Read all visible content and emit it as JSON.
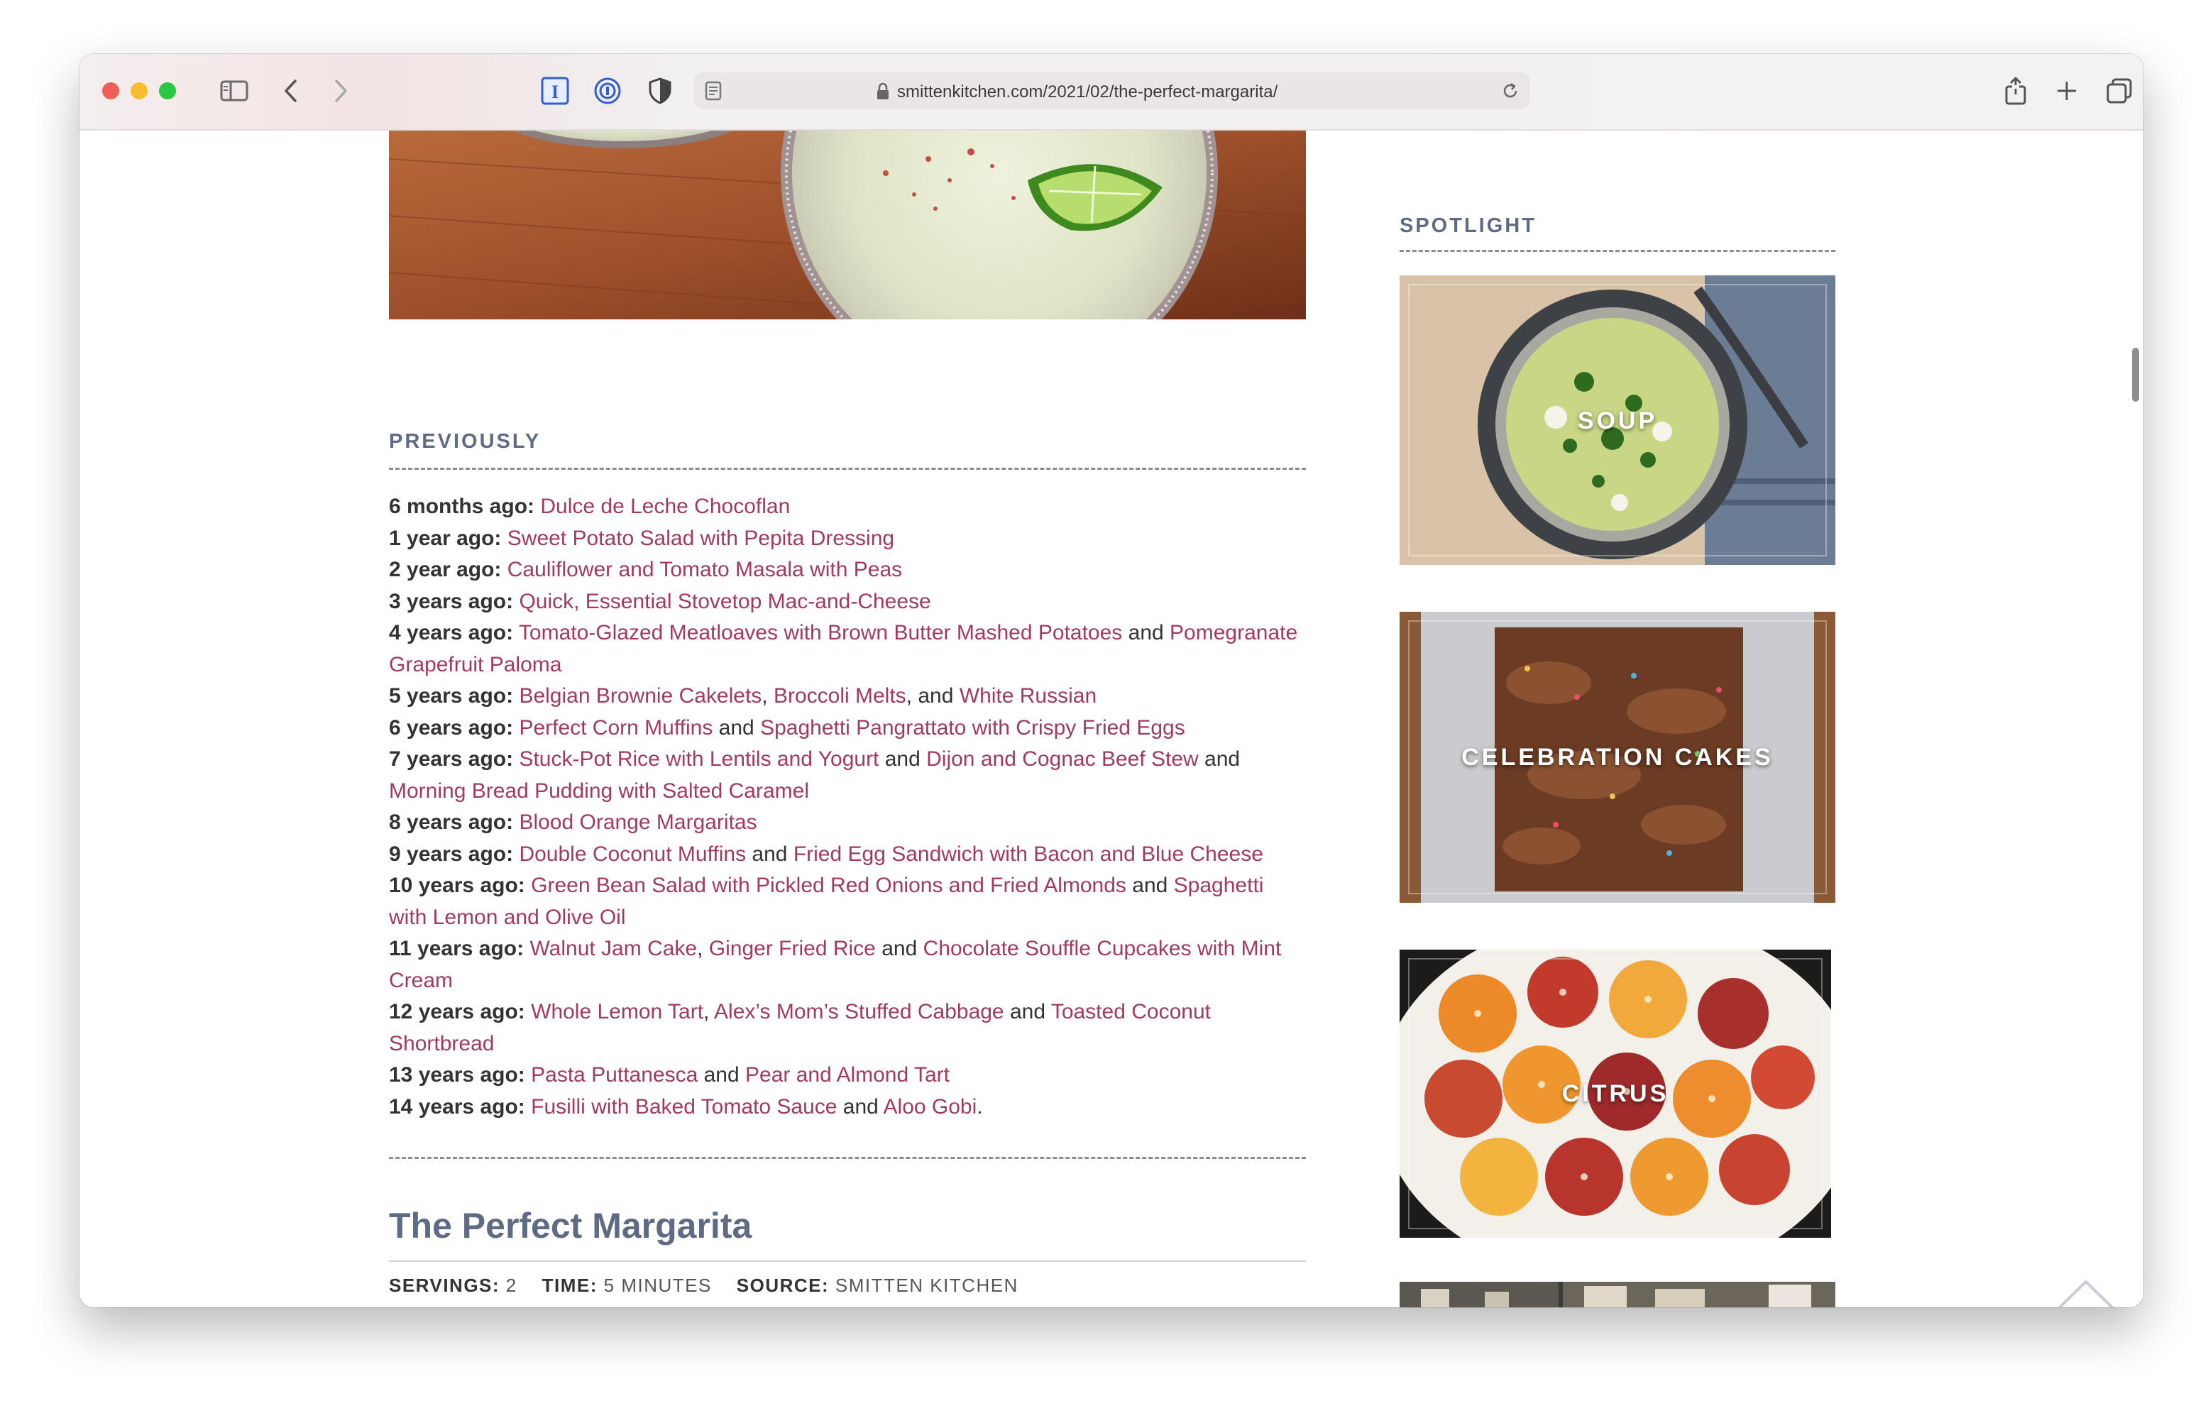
{
  "browser": {
    "url": "smittenkitchen.com/2021/02/the-perfect-margarita/"
  },
  "icons": {
    "sidebar": "sidebar-icon",
    "back": "chevron-left-icon",
    "forward": "chevron-right-icon",
    "share": "share-icon",
    "new_tab": "plus-icon",
    "tabs": "tab-overview-icon",
    "reload": "reload-icon",
    "lock": "lock-icon",
    "reader": "reader-icon",
    "to_top": "chevron-up-icon"
  },
  "colors": {
    "link": "#a23a5e",
    "heading": "#5f6b85",
    "body_text": "#333333"
  },
  "previously": {
    "heading": "PREVIOUSLY",
    "items": [
      {
        "when": "6 months ago:",
        "parts": [
          {
            "t": " "
          },
          {
            "l": "Dulce de Leche Chocoflan"
          }
        ]
      },
      {
        "when": "1 year ago:",
        "parts": [
          {
            "t": " "
          },
          {
            "l": "Sweet Potato Salad with Pepita Dressing"
          }
        ]
      },
      {
        "when": "2 year ago:",
        "parts": [
          {
            "t": " "
          },
          {
            "l": "Cauliflower and Tomato Masala with Peas"
          }
        ]
      },
      {
        "when": "3 years ago:",
        "parts": [
          {
            "t": " "
          },
          {
            "l": "Quick, Essential Stovetop Mac-and-Cheese"
          }
        ]
      },
      {
        "when": "4 years ago:",
        "parts": [
          {
            "t": " "
          },
          {
            "l": "Tomato-Glazed Meatloaves with Brown Butter Mashed Potatoes"
          },
          {
            "t": " and "
          },
          {
            "l": "Pomegranate Grapefruit Paloma"
          }
        ]
      },
      {
        "when": "5 years ago:",
        "parts": [
          {
            "t": " "
          },
          {
            "l": "Belgian Brownie Cakelets"
          },
          {
            "t": ", "
          },
          {
            "l": "Broccoli Melts"
          },
          {
            "t": ", and "
          },
          {
            "l": "White Russian"
          }
        ]
      },
      {
        "when": "6 years ago:",
        "parts": [
          {
            "t": " "
          },
          {
            "l": "Perfect Corn Muffins"
          },
          {
            "t": " and "
          },
          {
            "l": "Spaghetti Pangrattato with Crispy Fried Eggs"
          }
        ]
      },
      {
        "when": "7 years ago:",
        "parts": [
          {
            "t": " "
          },
          {
            "l": "Stuck-Pot Rice with Lentils and Yogurt"
          },
          {
            "t": " and "
          },
          {
            "l": "Dijon and Cognac Beef Stew"
          },
          {
            "t": " and "
          },
          {
            "l": "Morning Bread Pudding with Salted Caramel"
          }
        ]
      },
      {
        "when": "8 years ago:",
        "parts": [
          {
            "t": " "
          },
          {
            "l": "Blood Orange Margaritas"
          }
        ]
      },
      {
        "when": "9 years ago:",
        "parts": [
          {
            "t": " "
          },
          {
            "l": "Double Coconut Muffins"
          },
          {
            "t": " and "
          },
          {
            "l": "Fried Egg Sandwich with Bacon and Blue Cheese"
          }
        ]
      },
      {
        "when": "10 years ago:",
        "parts": [
          {
            "t": " "
          },
          {
            "l": "Green Bean Salad with Pickled Red Onions and Fried Almonds"
          },
          {
            "t": " and "
          },
          {
            "l": "Spaghetti with Lemon and Olive Oil"
          }
        ]
      },
      {
        "when": "11 years ago:",
        "parts": [
          {
            "t": " "
          },
          {
            "l": "Walnut Jam Cake"
          },
          {
            "t": ", "
          },
          {
            "l": "Ginger Fried Rice"
          },
          {
            "t": " and "
          },
          {
            "l": "Chocolate Souffle Cupcakes with Mint Cream"
          }
        ]
      },
      {
        "when": "12 years ago:",
        "parts": [
          {
            "t": " "
          },
          {
            "l": "Whole Lemon Tart"
          },
          {
            "t": ", "
          },
          {
            "l": "Alex’s Mom’s Stuffed Cabbage"
          },
          {
            "t": " and "
          },
          {
            "l": "Toasted Coconut Shortbread"
          }
        ]
      },
      {
        "when": "13 years ago:",
        "parts": [
          {
            "t": " "
          },
          {
            "l": "Pasta Puttanesca"
          },
          {
            "t": " and "
          },
          {
            "l": "Pear and Almond Tart"
          }
        ]
      },
      {
        "when": "14 years ago:",
        "parts": [
          {
            "t": " "
          },
          {
            "l": "Fusilli with Baked Tomato Sauce"
          },
          {
            "t": " and "
          },
          {
            "l": "Aloo Gobi"
          },
          {
            "t": "."
          }
        ]
      }
    ]
  },
  "recipe": {
    "title": "The Perfect Margarita",
    "servings_label": "SERVINGS:",
    "servings_value": "2",
    "time_label": "TIME:",
    "time_value": "5 MINUTES",
    "source_label": "SOURCE:",
    "source_value": "SMITTEN KITCHEN"
  },
  "spotlight": {
    "heading": "SPOTLIGHT",
    "tiles": [
      {
        "label": "SOUP"
      },
      {
        "label": "CELEBRATION CAKES"
      },
      {
        "label": "CITRUS"
      }
    ]
  }
}
